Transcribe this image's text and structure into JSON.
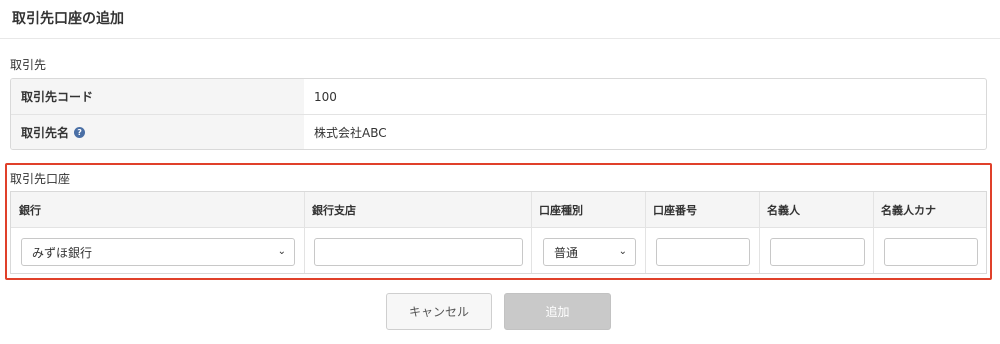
{
  "page": {
    "title": "取引先口座の追加"
  },
  "partner": {
    "section_label": "取引先",
    "rows": [
      {
        "key": "取引先コード",
        "value": "100"
      },
      {
        "key": "取引先名",
        "value": "株式会社ABC",
        "help_icon": "question-circle-icon"
      }
    ]
  },
  "account": {
    "section_label": "取引先口座",
    "columns": [
      "銀行",
      "銀行支店",
      "口座種別",
      "口座番号",
      "名義人",
      "名義人カナ"
    ],
    "fields": {
      "bank": {
        "value": "みずほ銀行"
      },
      "branch": {
        "value": ""
      },
      "account_type": {
        "value": "普通"
      },
      "account_number": {
        "value": ""
      },
      "holder": {
        "value": ""
      },
      "holder_kana": {
        "value": ""
      }
    }
  },
  "buttons": {
    "cancel": "キャンセル",
    "add": "追加"
  },
  "colors": {
    "highlight": "#e0402a",
    "help_icon": "#4a6fa5",
    "add_disabled": "#c9c9c9"
  }
}
